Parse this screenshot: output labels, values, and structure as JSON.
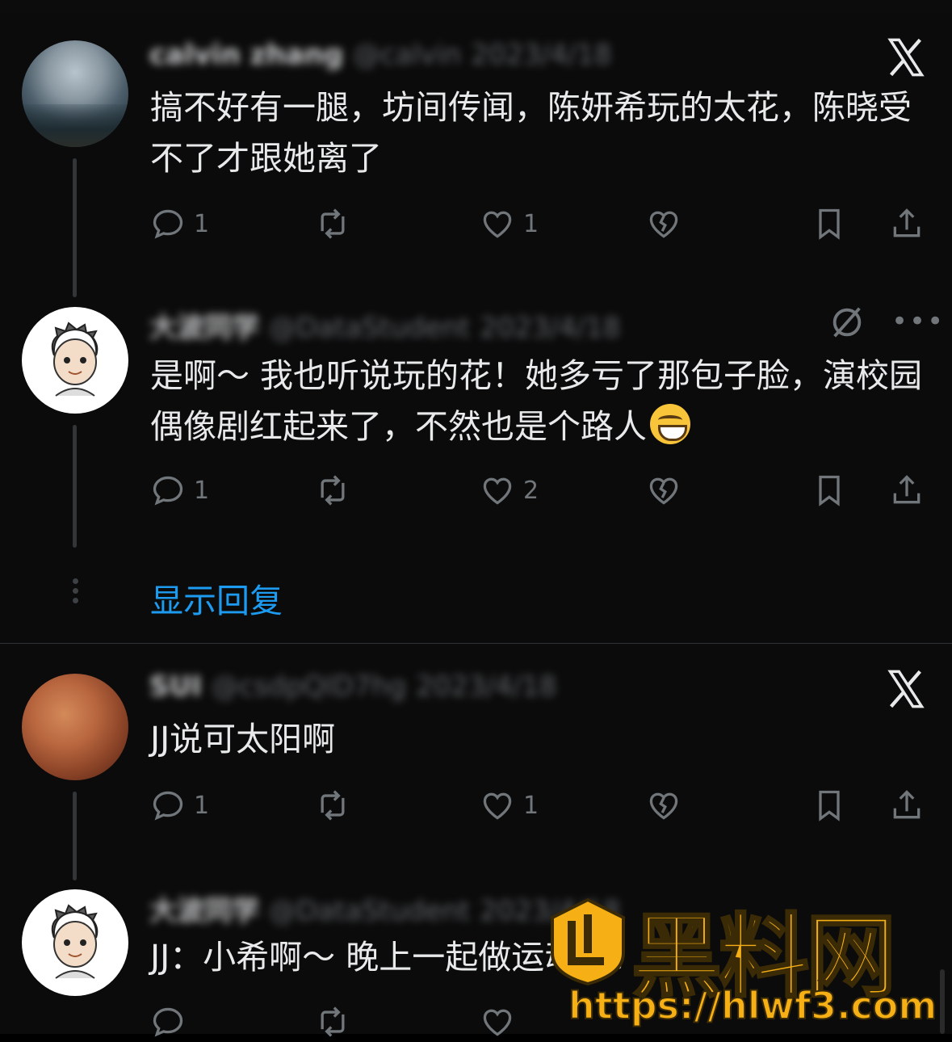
{
  "replies": [
    {
      "author": "calvin zhang",
      "handle": "@calvin",
      "date": "2023/4/18",
      "text": "搞不好有一腿，坊间传闻，陈妍希玩的太花，陈晓受不了才跟她离了",
      "counts": {
        "reply": "1",
        "like": "1"
      }
    },
    {
      "author": "大波同学",
      "handle": "@DataStudent",
      "date": "2023/4/18",
      "text": "是啊～ 我也听说玩的花！她多亏了那包子脸，演校园偶像剧红起来了，不然也是个路人",
      "counts": {
        "reply": "1",
        "like": "2"
      }
    },
    {
      "author": "SUI",
      "handle": "@csdpQID7hg",
      "date": "2023/4/18",
      "text": "JJ说可太阳啊",
      "counts": {
        "reply": "1",
        "like": "1"
      }
    },
    {
      "author": "大波同学",
      "handle": "@DataStudent",
      "date": "2023/4/18",
      "text": "JJ：小希啊～ 晚上一起做运动呀！"
    }
  ],
  "show_replies": "显示回复",
  "watermark": {
    "title": "黑料网",
    "url": "https://hlwf3.com"
  },
  "colors": {
    "background": "#000000",
    "panel": "#0b0b0b",
    "text": "#e7e9ea",
    "muted": "#71767b",
    "link": "#1d9bf0",
    "watermark": "#f6b015"
  },
  "icons": [
    "reply-icon",
    "repost-icon",
    "like-icon",
    "dislike-icon",
    "bookmark-icon",
    "share-icon",
    "x-logo-icon",
    "more-icon",
    "grok-icon"
  ]
}
